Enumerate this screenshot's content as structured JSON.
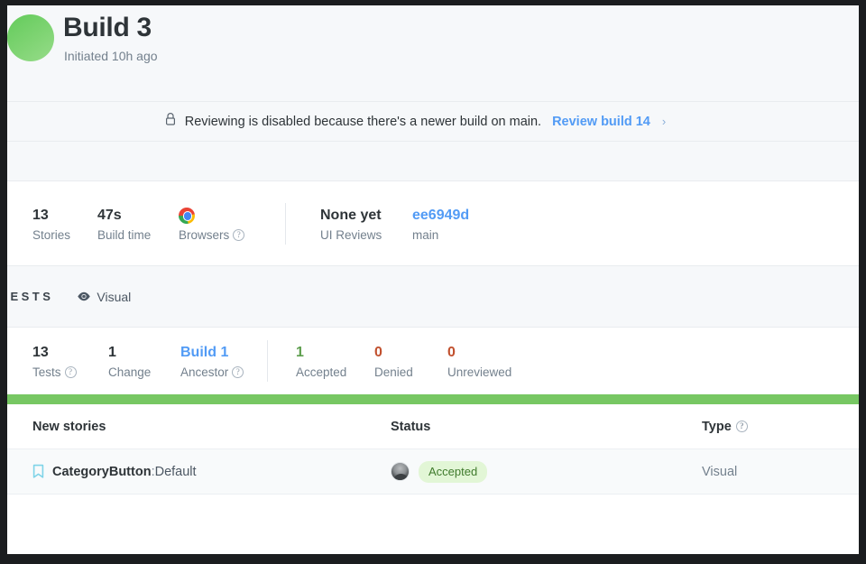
{
  "header": {
    "title": "Build 3",
    "subtitle": "Initiated 10h ago",
    "avatar_color": "#77d06b"
  },
  "banner": {
    "icon": "lock-icon",
    "message": "Reviewing is disabled because there's a newer build on main.",
    "link_label": "Review build 14",
    "chevron": "›"
  },
  "build_stats": [
    {
      "value": "13",
      "label": "Stories",
      "help": false
    },
    {
      "value": "47s",
      "label": "Build time",
      "help": false
    },
    {
      "value": "",
      "label": "Browsers",
      "help": true,
      "icon": "chrome-icon"
    },
    {
      "value": "None yet",
      "label": "UI Reviews",
      "help": false
    },
    {
      "value": "ee6949d",
      "label": "main",
      "help": false,
      "color": "blue"
    }
  ],
  "tests_section": {
    "label": "TESTS",
    "tab_icon": "eye-icon",
    "tab_label": "Visual"
  },
  "test_stats": [
    {
      "value": "13",
      "label": "Tests",
      "help": true
    },
    {
      "value": "1",
      "label": "Change",
      "help": false
    },
    {
      "value": "Build 1",
      "label": "Ancestor",
      "help": true,
      "color": "blue"
    },
    {
      "value": "1",
      "label": "Accepted",
      "help": false,
      "color": "green"
    },
    {
      "value": "0",
      "label": "Denied",
      "help": false,
      "color": "orange"
    },
    {
      "value": "0",
      "label": "Unreviewed",
      "help": false,
      "color": "orange"
    }
  ],
  "table": {
    "columns": {
      "stories": "New stories",
      "status": "Status",
      "type": "Type"
    },
    "rows": [
      {
        "icon": "bookmark-icon",
        "component": "CategoryButton",
        "separator": ":",
        "variant": "Default",
        "avatar": "user-avatar",
        "status": "Accepted",
        "type": "Visual"
      }
    ]
  },
  "colors": {
    "accent_green": "#77c763",
    "link_blue": "#529bf5",
    "accepted_green": "#3f7a2c",
    "denied_orange": "#c1502e",
    "bookmark_cyan": "#7fd4e8"
  }
}
